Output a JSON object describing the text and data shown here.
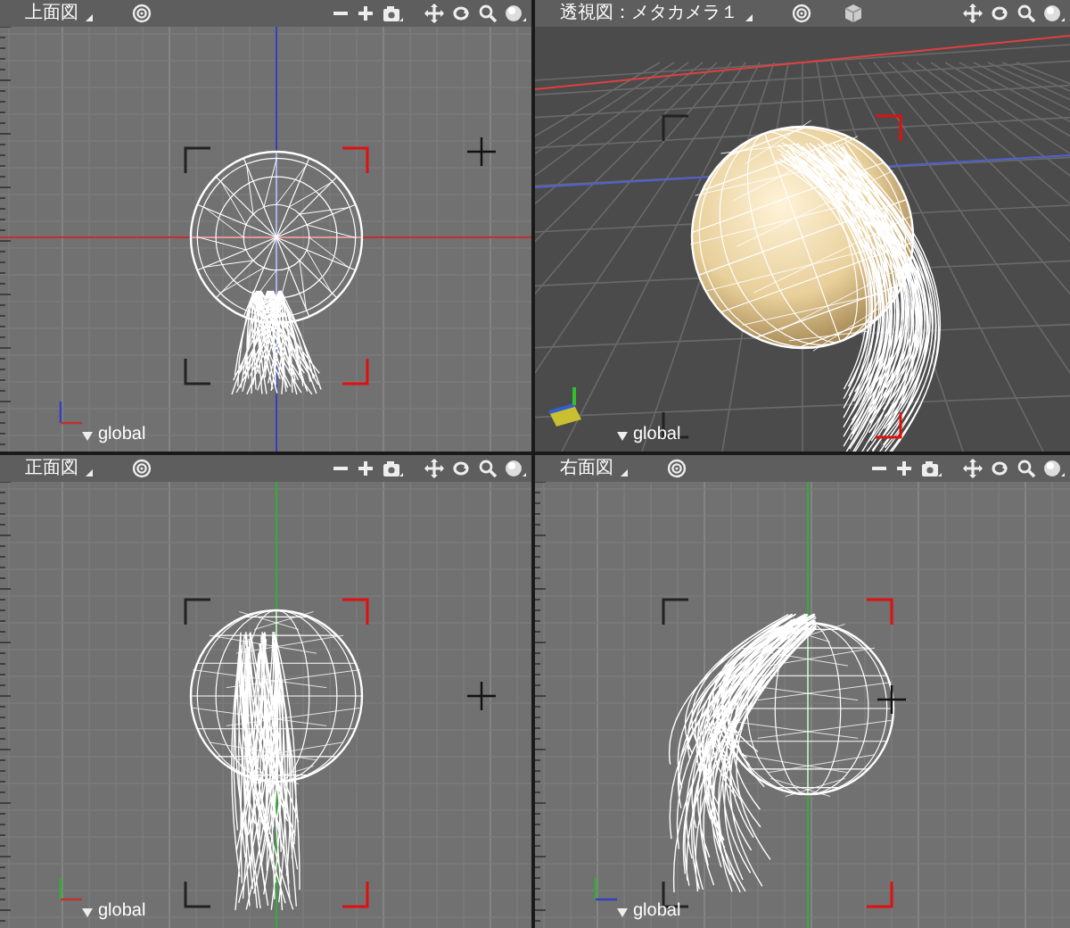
{
  "viewports": [
    {
      "kind": "top",
      "title": "上面図",
      "zoom_controls": true,
      "camera_object": false,
      "coord_label": "global"
    },
    {
      "kind": "perspective",
      "title": "透視図：メタカメラ１",
      "zoom_controls": false,
      "camera_object": true,
      "coord_label": "global"
    },
    {
      "kind": "front",
      "title": "正面図",
      "zoom_controls": true,
      "camera_object": false,
      "coord_label": "global"
    },
    {
      "kind": "side",
      "title": "右面図",
      "zoom_controls": true,
      "camera_object": false,
      "coord_label": "global"
    }
  ]
}
